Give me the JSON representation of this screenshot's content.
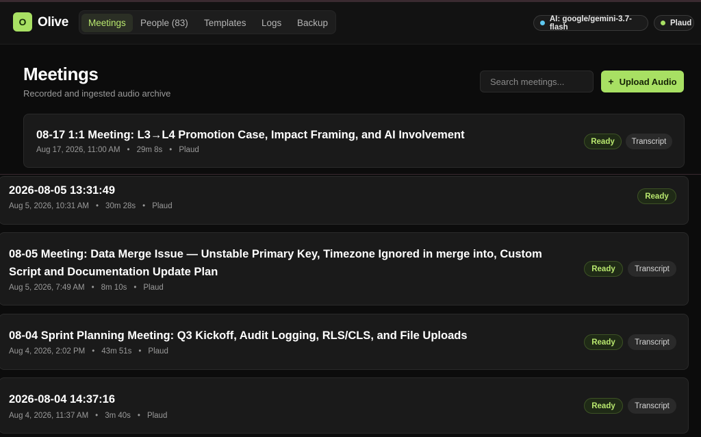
{
  "app": {
    "logo_letter": "O",
    "name": "Olive"
  },
  "nav": {
    "items": [
      {
        "label": "Meetings",
        "active": true
      },
      {
        "label": "People (83)"
      },
      {
        "label": "Templates"
      },
      {
        "label": "Logs"
      },
      {
        "label": "Backup"
      }
    ]
  },
  "status": {
    "ai_label": "AI: google/gemini-3.7-flash",
    "ai_dot_color": "#5ec8f0",
    "source_label": "Plaud",
    "source_dot_color": "#a8e063"
  },
  "page": {
    "title": "Meetings",
    "subtitle": "Recorded and ingested audio archive",
    "search_placeholder": "Search meetings...",
    "upload_icon": "+",
    "upload_label": "Upload Audio"
  },
  "meetings": [
    {
      "title": "08-17 1:1 Meeting: L3→L4 Promotion Case, Impact Framing, and AI Involvement",
      "date": "Aug 17, 2026, 11:00 AM",
      "duration": "29m 8s",
      "source": "Plaud",
      "status": "Ready",
      "transcript": "Transcript"
    },
    {
      "title": "2026-08-05 13:31:49",
      "date": "Aug 5, 2026, 10:31 AM",
      "duration": "30m 28s",
      "source": "Plaud",
      "status": "Ready"
    },
    {
      "title": "08-05 Meeting: Data Merge Issue — Unstable Primary Key, Timezone Ignored in merge into, Custom Script and Documentation Update Plan",
      "date": "Aug 5, 2026, 7:49 AM",
      "duration": "8m 10s",
      "source": "Plaud",
      "status": "Ready",
      "transcript": "Transcript"
    },
    {
      "title": "08-04 Sprint Planning Meeting: Q3 Kickoff, Audit Logging, RLS/CLS, and File Uploads",
      "date": "Aug 4, 2026, 2:02 PM",
      "duration": "43m 51s",
      "source": "Plaud",
      "status": "Ready",
      "transcript": "Transcript"
    },
    {
      "title": "2026-08-04 14:37:16",
      "date": "Aug 4, 2026, 11:37 AM",
      "duration": "3m 40s",
      "source": "Plaud",
      "status": "Ready",
      "transcript": "Transcript"
    }
  ],
  "meta_separator": "•"
}
